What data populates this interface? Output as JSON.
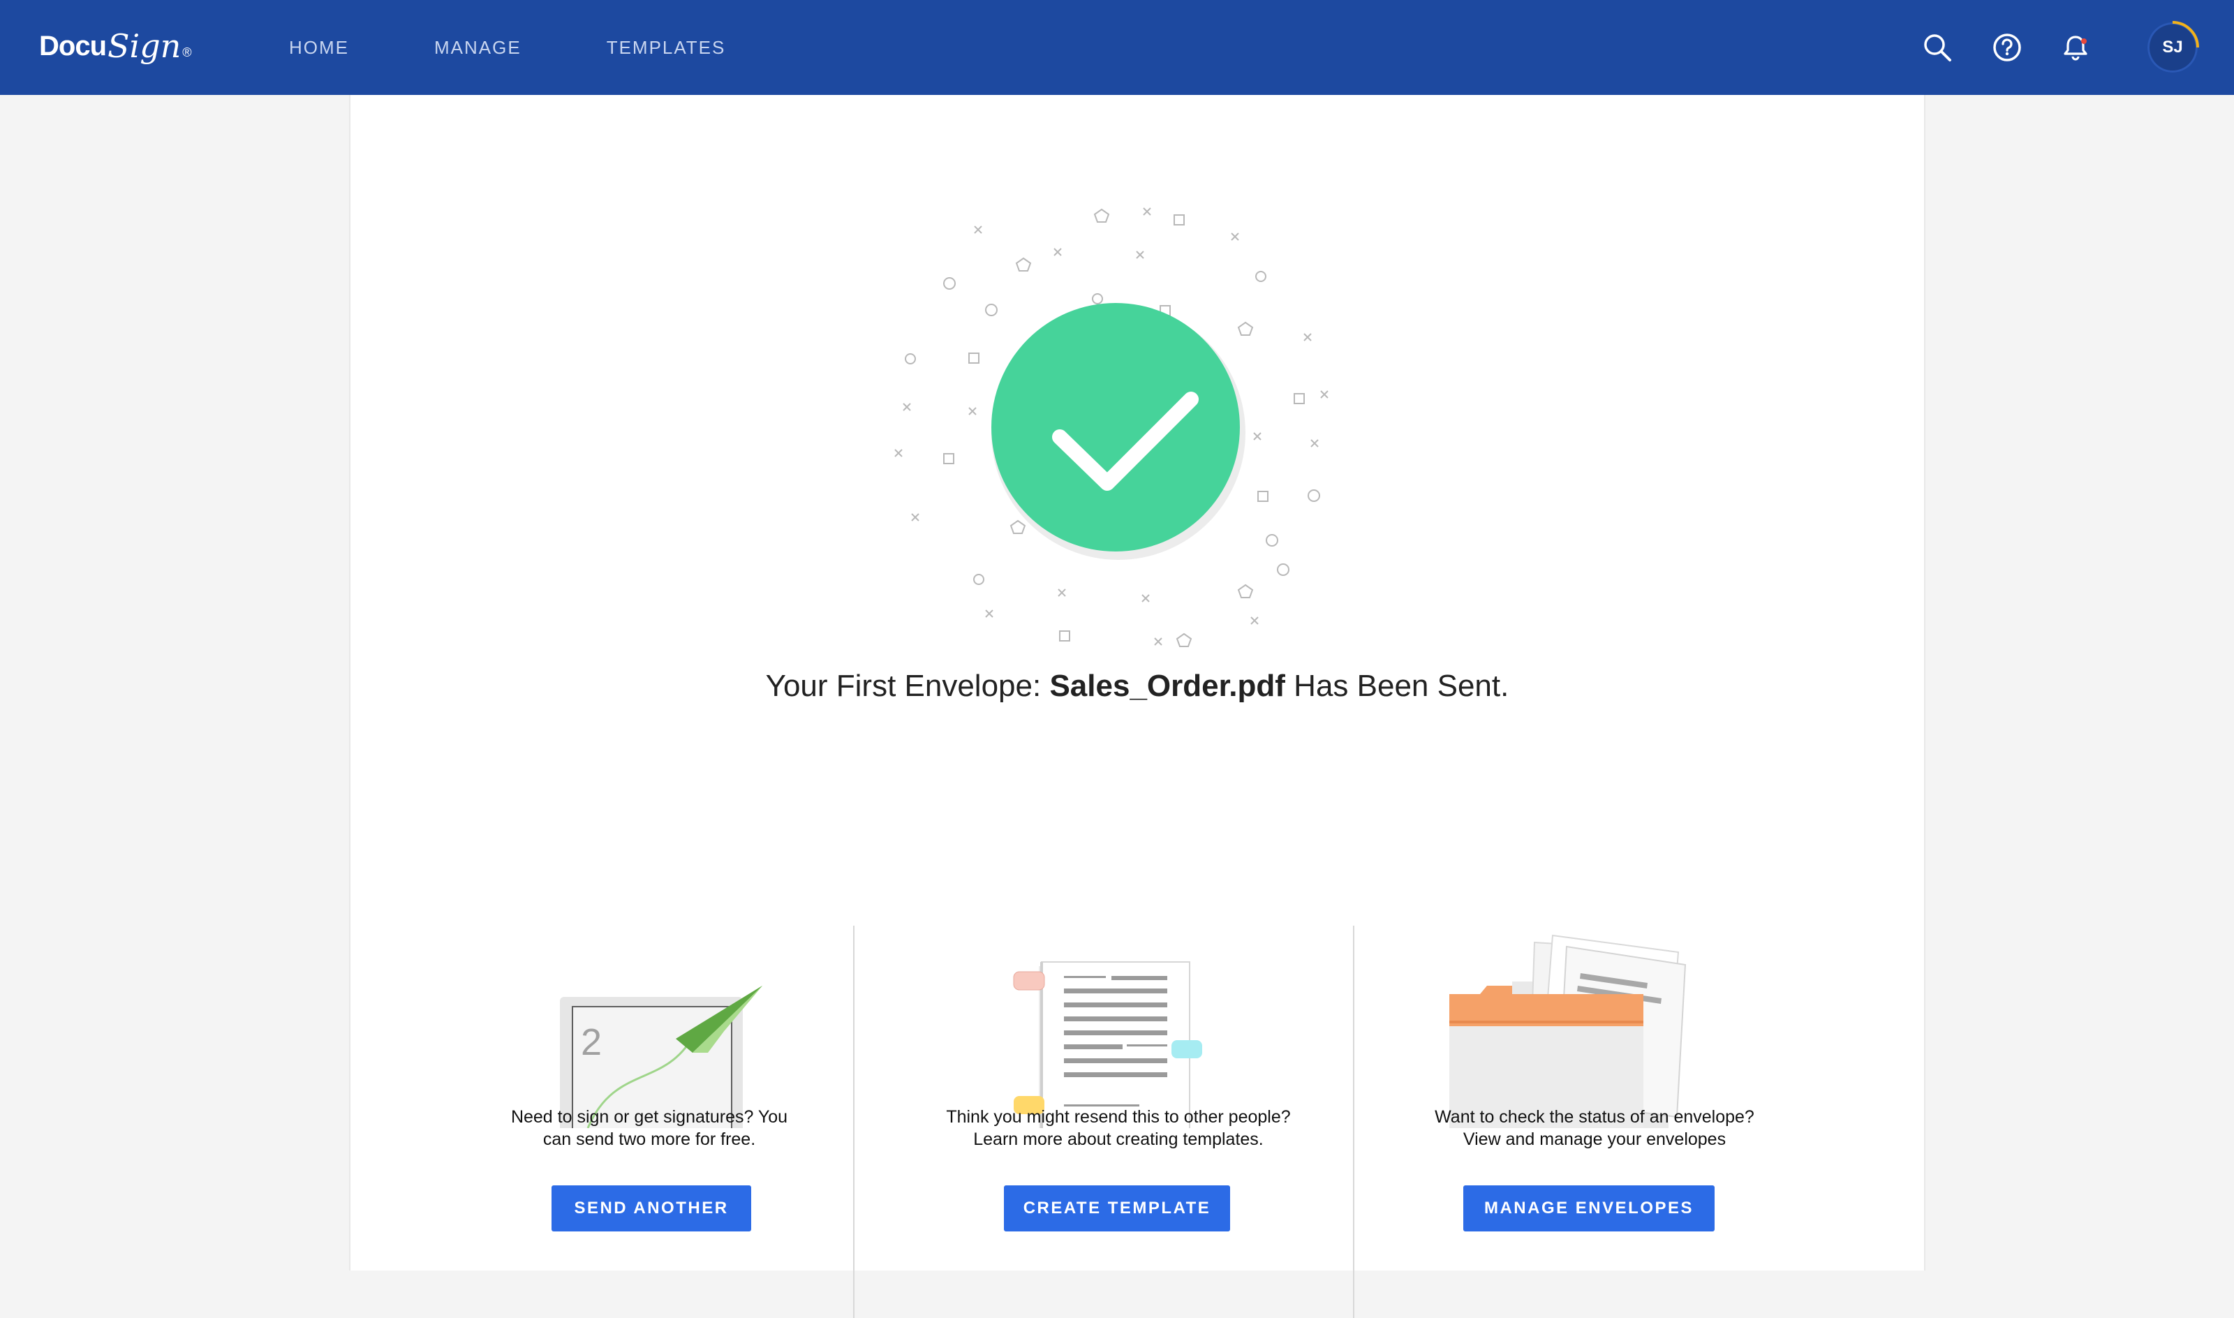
{
  "header": {
    "logo": {
      "part1": "Docu",
      "part2": "Sign",
      "mark": "®"
    },
    "nav": [
      "HOME",
      "MANAGE",
      "TEMPLATES"
    ],
    "icons": [
      "search-icon",
      "help-icon",
      "bell-icon"
    ],
    "avatar_initials": "SJ",
    "colors": {
      "bar": "#1d49a0",
      "nav_text": "#c9d6f0"
    }
  },
  "main": {
    "headline": {
      "prefix": "Your First Envelope: ",
      "filename": "Sales_Order.pdf",
      "suffix": " Has Been Sent."
    },
    "success_icon": "checkmark-circle-icon",
    "success_color": "#46d39a",
    "actions": [
      {
        "illustration": "laptop-paper-plane-illustration",
        "illustration_number": "2",
        "text_line1": "Need to sign or get signatures? You",
        "text_line2": "can send two more for free.",
        "button": "SEND ANOTHER"
      },
      {
        "illustration": "document-tabs-illustration",
        "text_line1": "Think you might resend this to other people?",
        "text_line2": "Learn more about creating templates.",
        "button": "CREATE TEMPLATE"
      },
      {
        "illustration": "folder-envelopes-illustration",
        "text_line1": "Want to check the status of an envelope?",
        "text_line2": "View and manage your envelopes",
        "button": "MANAGE ENVELOPES"
      }
    ],
    "button_color": "#2c6be6"
  }
}
